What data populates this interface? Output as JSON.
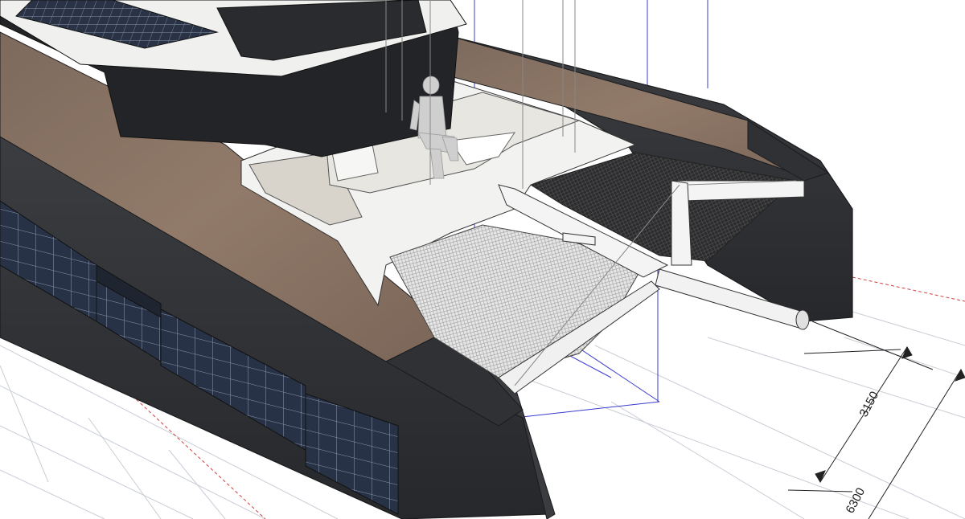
{
  "viewport": {
    "colors": {
      "background": "#ffffff",
      "grid": "#c9cdd6",
      "axis_red": "#d04040",
      "axis_blue": "#3b3bd0",
      "hull": "#2f3134",
      "hull_edge": "#1a1b1d",
      "deck_wood": "#8a7464",
      "deck_white": "#f2f2f0",
      "cabin": "#232427",
      "solar": "#2b3547",
      "net": "#d9d9d9",
      "figure": "#cfcfcf"
    }
  },
  "dimensions": {
    "hull_spacing_label": "3150",
    "overall_beam_label": "6300"
  }
}
